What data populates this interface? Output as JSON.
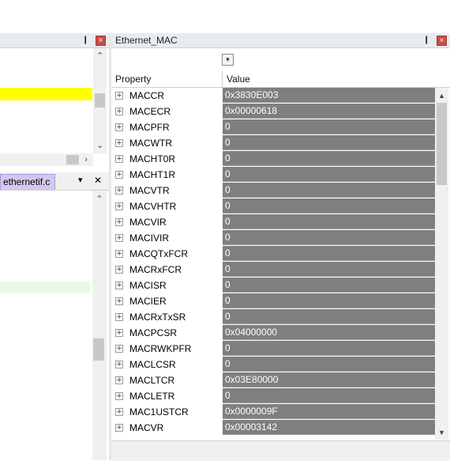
{
  "left_top_pane": {
    "header_pin": "❙"
  },
  "left_bottom_pane": {
    "tab_label": "ethernetif.c",
    "dropdown_glyph": "▾",
    "close_glyph": "✕"
  },
  "right_pane": {
    "title": "Ethernet_MAC",
    "columns": {
      "property": "Property",
      "value": "Value"
    },
    "rows": [
      {
        "name": "MACCR",
        "value": "0x3830E003"
      },
      {
        "name": "MACECR",
        "value": "0x00000618"
      },
      {
        "name": "MACPFR",
        "value": "0"
      },
      {
        "name": "MACWTR",
        "value": "0"
      },
      {
        "name": "MACHT0R",
        "value": "0"
      },
      {
        "name": "MACHT1R",
        "value": "0"
      },
      {
        "name": "MACVTR",
        "value": "0"
      },
      {
        "name": "MACVHTR",
        "value": "0"
      },
      {
        "name": "MACVIR",
        "value": "0"
      },
      {
        "name": "MACIVIR",
        "value": "0"
      },
      {
        "name": "MACQTxFCR",
        "value": "0"
      },
      {
        "name": "MACRxFCR",
        "value": "0"
      },
      {
        "name": "MACISR",
        "value": "0"
      },
      {
        "name": "MACIER",
        "value": "0"
      },
      {
        "name": "MACRxTxSR",
        "value": "0"
      },
      {
        "name": "MACPCSR",
        "value": "0x04000000"
      },
      {
        "name": "MACRWKPFR",
        "value": "0"
      },
      {
        "name": "MACLCSR",
        "value": "0"
      },
      {
        "name": "MACLTCR",
        "value": "0x03E80000"
      },
      {
        "name": "MACLETR",
        "value": "0"
      },
      {
        "name": "MAC1USTCR",
        "value": "0x0000009F"
      },
      {
        "name": "MACVR",
        "value": "0x00003142"
      }
    ]
  },
  "colors": {
    "value_cell_bg": "#7f7f7f",
    "highlight_yellow": "#ffff00",
    "highlight_green": "#eaf8e8",
    "close_red": "#c94c4c",
    "tab_purple": "#d3c8f0"
  }
}
